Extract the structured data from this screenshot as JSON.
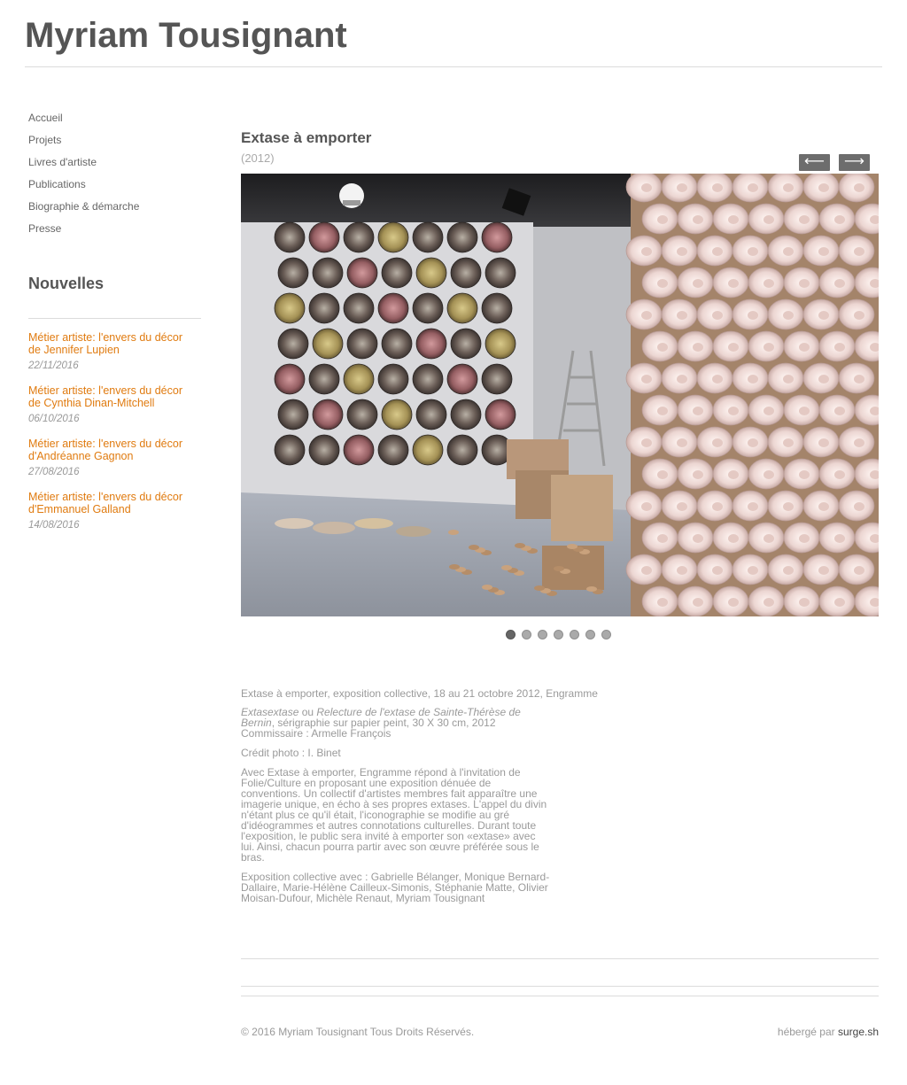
{
  "site": {
    "title": "Myriam Tousignant"
  },
  "nav": {
    "items": [
      {
        "label": "Accueil"
      },
      {
        "label": "Projets"
      },
      {
        "label": "Livres d'artiste"
      },
      {
        "label": "Publications"
      },
      {
        "label": "Biographie & démarche"
      },
      {
        "label": "Presse"
      }
    ]
  },
  "news": {
    "heading": "Nouvelles",
    "items": [
      {
        "title": "Métier artiste: l'envers du décor de Jennifer Lupien",
        "date": "22/11/2016"
      },
      {
        "title": "Métier artiste: l'envers du décor de Cynthia Dinan-Mitchell",
        "date": "06/10/2016"
      },
      {
        "title": "Métier artiste: l'envers du décor d'Andréanne Gagnon",
        "date": "27/08/2016"
      },
      {
        "title": "Métier artiste: l'envers du décor d'Emmanuel Galland",
        "date": "14/08/2016"
      }
    ]
  },
  "project": {
    "title": "Extase à emporter",
    "year": "(2012)",
    "prev_label": "⟵",
    "next_label": "⟶",
    "slides_total": 7,
    "active_slide": 1,
    "description": {
      "line1": "Extase à emporter, exposition collective, 18 au 21 octobre 2012, Engramme",
      "work_title": "Extasextase",
      "work_or": " ou ",
      "work_alt_title": "Relecture de l'extase de Sainte-Thérèse de Bernin",
      "work_details": ", sérigraphie sur papier peint, 30 X 30 cm, 2012",
      "curator": "Commissaire : Armelle François",
      "credit": "Crédit photo : I. Binet",
      "body": "Avec Extase à emporter, Engramme répond à l'invitation de Folie/Culture en proposant une exposition dénuée de conventions. Un collectif d'artistes membres fait apparaître une imagerie unique, en écho à ses propres extases. L'appel du divin n'étant plus ce qu'il était, l'iconographie se modifie au gré d'idéogrammes et autres connotations culturelles. Durant toute l'exposition, le public sera invité à emporter son «extase» avec lui. Ainsi, chacun pourra partir avec son œuvre préférée sous le bras.",
      "artists": "Exposition collective avec : Gabrielle Bélanger, Monique Bernard-Dallaire, Marie-Hélène Cailleux-Simonis, Stéphanie Matte, Olivier Moisan-Dufour, Michèle Renaut, Myriam Tousignant"
    }
  },
  "footer": {
    "copyright": "© 2016 Myriam Tousignant Tous Droits Réservés.",
    "hosted_prefix": "hébergé par ",
    "hosted_link": "surge.sh"
  },
  "colors": {
    "accent": "#e07b10",
    "text": "#555555",
    "muted": "#999999",
    "button": "#6d6d6d"
  }
}
